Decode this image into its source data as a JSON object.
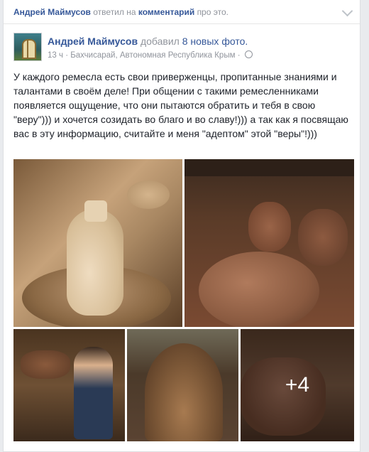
{
  "story": {
    "actor": "Андрей Маймусов",
    "verb": "ответил на",
    "target": "комментарий",
    "suffix": "про это."
  },
  "post": {
    "author": "Андрей Маймусов",
    "action": "добавил",
    "photo_count_label": "8 новых фото.",
    "time": "13 ч",
    "location": "Бахчисарай, Автономная Республика Крым",
    "separator": "·",
    "text": "У каждого ремесла есть свои приверженцы, пропитанные знаниями и талантами в своём деле! При общении с такими ремесленниками появляется ощущение, что они пытаются обратить и тебя в свою \"веру\"))) и хочется созидать во благо и во славу!))) а так как я посвящаю вас в эту информацию, считайте и меня \"адептом\" этой \"веры\"!)))",
    "more_photos": "+4"
  },
  "icons": [
    "chevron-down-icon",
    "globe-icon"
  ]
}
